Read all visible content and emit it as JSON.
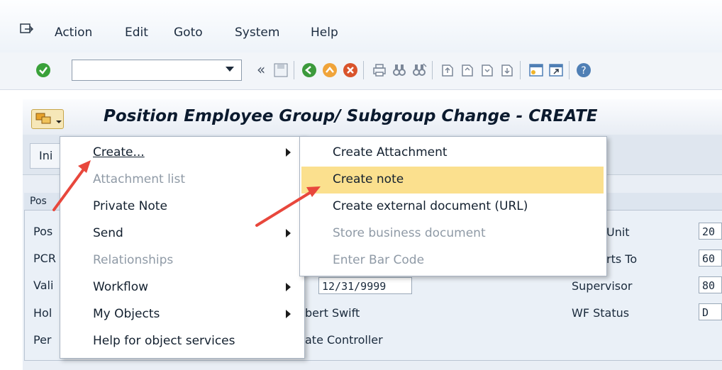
{
  "menubar": {
    "items": [
      "Action",
      "Edit",
      "Goto",
      "System",
      "Help"
    ]
  },
  "toolbar": {
    "command_field_value": "",
    "icons": [
      "check-icon",
      "command-dropdown",
      "back-arrows-icon",
      "save-icon",
      "back-icon",
      "exit-icon",
      "cancel-icon",
      "print-icon",
      "find-icon",
      "find-next-icon",
      "first-page-icon",
      "prev-page-icon",
      "next-page-icon",
      "last-page-icon",
      "new-session-icon",
      "shortcut-icon",
      "help-icon"
    ]
  },
  "page": {
    "title": "Position Employee Group/ Subgroup Change - CREATE",
    "tab_partial": "Ini",
    "panel_head_partial": "Pos"
  },
  "fields_left": [
    "Pos",
    "PCR",
    "Vali",
    "Hol",
    "Per"
  ],
  "field_values": {
    "valid_to": "12/31/9999",
    "holder_partial": "bert Swift",
    "personnel_partial": "ate Controller"
  },
  "fields_right": [
    {
      "label": "Unit",
      "value": "20"
    },
    {
      "label": "rts To",
      "value": "60"
    },
    {
      "label": "Supervisor",
      "value": "80"
    },
    {
      "label": "WF Status",
      "value": "D"
    }
  ],
  "menu_main": {
    "items": [
      {
        "label": "Create...",
        "disabled": false,
        "submenu": true
      },
      {
        "label": "Attachment list",
        "disabled": true,
        "submenu": false
      },
      {
        "label": "Private Note",
        "disabled": false,
        "submenu": false
      },
      {
        "label": "Send",
        "disabled": false,
        "submenu": true
      },
      {
        "label": "Relationships",
        "disabled": true,
        "submenu": false
      },
      {
        "label": "Workflow",
        "disabled": false,
        "submenu": true
      },
      {
        "label": "My Objects",
        "disabled": false,
        "submenu": true
      },
      {
        "label": "Help for object services",
        "disabled": false,
        "submenu": false
      }
    ]
  },
  "menu_sub": {
    "items": [
      {
        "label": "Create Attachment",
        "disabled": false,
        "highlighted": false
      },
      {
        "label": "Create note",
        "disabled": false,
        "highlighted": true
      },
      {
        "label": "Create external document (URL)",
        "disabled": false,
        "highlighted": false
      },
      {
        "label": "Store business document",
        "disabled": true,
        "highlighted": false
      },
      {
        "label": "Enter Bar Code",
        "disabled": true,
        "highlighted": false
      }
    ]
  },
  "colors": {
    "highlight": "#fbe08e",
    "annotation_arrow": "#e8473c",
    "check_green": "#3aa13a"
  }
}
